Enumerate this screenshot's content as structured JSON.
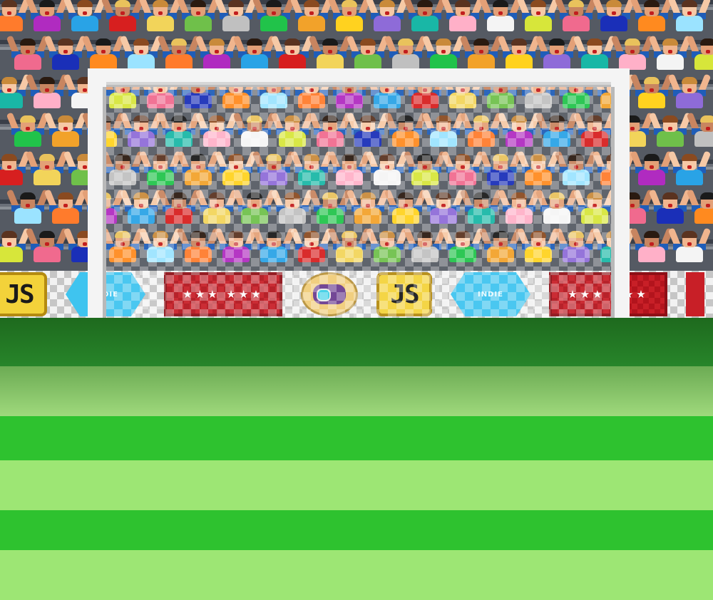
{
  "scene": {
    "type": "penalty-kick",
    "view": "behind-the-penalty-spot"
  },
  "crowd": {
    "rows": 7,
    "fans_per_row": 19,
    "shirt_colors": [
      "#ff7b2c",
      "#f4f4f4",
      "#21c34a",
      "#b02bc0",
      "#d7e63a",
      "#f2a22a",
      "#29a3e6",
      "#f06a8e",
      "#ffd21f",
      "#d71f1f",
      "#1a2fb8",
      "#8e6bd8",
      "#f2d45a",
      "#ff8a1f",
      "#19b7a6",
      "#6fc04a",
      "#9be3ff",
      "#ffb0c8",
      "#c0c0c0"
    ],
    "hair_colors": [
      "#5a3320",
      "#2a1a10",
      "#c98a3a",
      "#e9c25c",
      "#8a4a20",
      "#1a1a1a"
    ],
    "skin_colors": [
      "#f0b58e",
      "#e3a077",
      "#f6c9a6",
      "#c88560"
    ]
  },
  "adboards": {
    "sequence": [
      "js",
      "hex",
      "stars",
      "pad",
      "js",
      "hex",
      "stars",
      "red",
      "pad"
    ],
    "js_text": "JS",
    "hex_text": "INDIE",
    "stars_text": "★★★ ★★★",
    "colors": {
      "js": "#f3d23a",
      "hex": "#3fc4ef",
      "stars": "#c81f27",
      "pad": "#f0cc78"
    }
  },
  "goal": {
    "frame_color": "#f4f4f4",
    "net": "checkered"
  },
  "pitch": {
    "stripes": [
      "#1f7a1f",
      "#8ccf6c",
      "#2ec22f",
      "#9de674",
      "#2ec22f",
      "#9de674"
    ]
  }
}
